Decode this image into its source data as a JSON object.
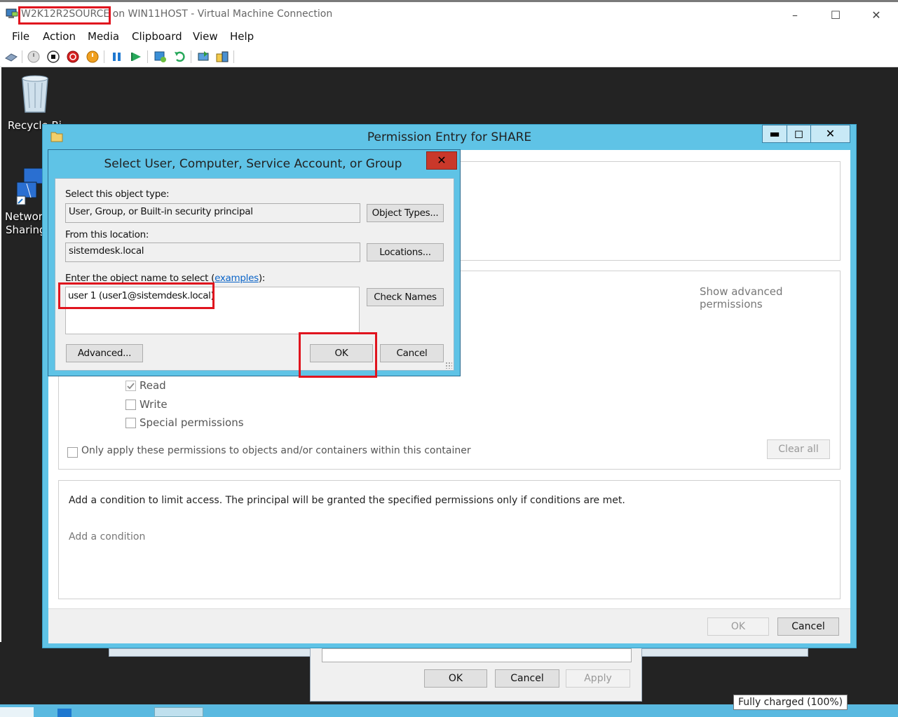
{
  "host": {
    "title_vm": "W2K12R2SOURCE",
    "title_rest": " on WIN11HOST - Virtual Machine Connection",
    "controls": {
      "minimize": "–",
      "maximize": "☐",
      "close": "✕"
    },
    "menu": [
      "File",
      "Action",
      "Media",
      "Clipboard",
      "View",
      "Help"
    ]
  },
  "desktop": {
    "icons": [
      {
        "label": "Recycle Bi"
      },
      {
        "label_line1": "Networl",
        "label_line2": "Sharing"
      }
    ]
  },
  "permission_entry": {
    "title": "Permission Entry for SHARE",
    "controls": {
      "minimize": "▬",
      "maximize": "◻",
      "close": "✕"
    },
    "show_advanced": "Show advanced permissions",
    "permissions": [
      {
        "label": "Read",
        "checked": true
      },
      {
        "label": "Write",
        "checked": false
      },
      {
        "label": "Special permissions",
        "checked": false
      }
    ],
    "only_apply_label": "Only apply these permissions to objects and/or containers within this container",
    "clear_all": "Clear all",
    "condition_text": "Add a condition to limit access. The principal will be granted the specified permissions only if conditions are met.",
    "add_condition": "Add a condition",
    "ok": "OK",
    "cancel": "Cancel"
  },
  "behind_dialog": {
    "ok": "OK",
    "cancel": "Cancel",
    "apply": "Apply"
  },
  "tooltip": "Fully charged (100%)",
  "select_dialog": {
    "title": "Select User, Computer, Service Account, or Group",
    "close": "✕",
    "object_type_label": "Select this object type:",
    "object_type_value": "User, Group, or Built-in security principal",
    "object_types_btn": "Object Types...",
    "location_label": "From this location:",
    "location_value": "sistemdesk.local",
    "locations_btn": "Locations...",
    "enter_label_prefix": "Enter the object name to select (",
    "enter_label_link": "examples",
    "enter_label_suffix": "):",
    "names_value": "user 1 (user1@sistemdesk.local)",
    "check_names_btn": "Check Names",
    "advanced_btn": "Advanced...",
    "ok_btn": "OK",
    "cancel_btn": "Cancel"
  },
  "colors": {
    "highlight": "#e0141e",
    "dialog_frame": "#5fc3e6",
    "link": "#0a64c8"
  }
}
